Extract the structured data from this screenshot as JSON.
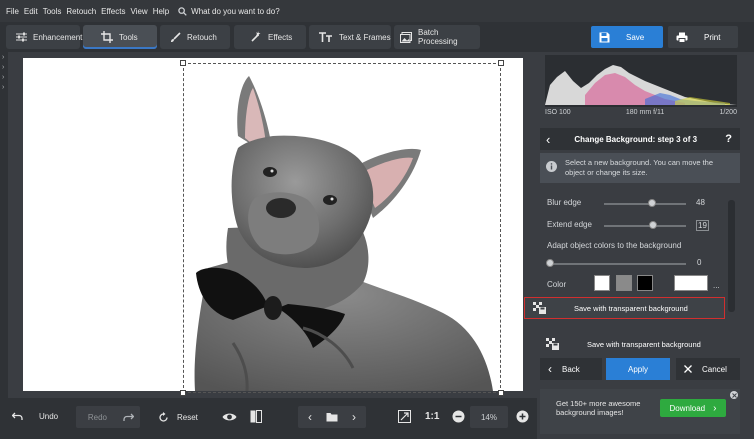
{
  "menu": [
    "File",
    "Edit",
    "Tools",
    "Retouch",
    "Effects",
    "View",
    "Help"
  ],
  "search_placeholder": "What do you want to do?",
  "tabs": [
    {
      "label": "Enhancement",
      "icon": "sliders-icon"
    },
    {
      "label": "Tools",
      "icon": "crop-icon"
    },
    {
      "label": "Retouch",
      "icon": "brush-icon"
    },
    {
      "label": "Effects",
      "icon": "magic-wand-icon"
    },
    {
      "label": "Text & Frames",
      "icon": "text-icon"
    },
    {
      "label": "Batch Processing",
      "icon": "images-icon"
    }
  ],
  "save_label": "Save",
  "print_label": "Print",
  "exif": {
    "iso": "ISO 100",
    "lens": "180 mm f/11",
    "shutter": "1/200"
  },
  "panel": {
    "step_title": "Change Background: step 3 of 3",
    "help": "?",
    "info": "Select a new background. You can move the object or change its size.",
    "blur_label": "Blur edge",
    "blur_value": "48",
    "blur_level": 0.58,
    "extend_label": "Extend edge",
    "extend_value": "19",
    "extend_level": 0.6,
    "adapt_label": "Adapt object colors to the background",
    "adapt_value": "0",
    "adapt_level": 0.0,
    "color_label": "Color",
    "more": "...",
    "save_transparent": "Save with transparent background",
    "save_transparent_2": "Save with transparent background",
    "back": "Back",
    "apply": "Apply",
    "cancel": "Cancel"
  },
  "promo": {
    "text": "Get 150+ more awesome background images!",
    "download": "Download"
  },
  "bottom": {
    "undo": "Undo",
    "redo": "Redo",
    "reset": "Reset",
    "ratio": "1:1",
    "zoom": "14%"
  },
  "colors": {
    "accent": "#2a7fd6",
    "apply": "#2a7fd6",
    "download": "#2eaa3f",
    "highlight": "#d12f2f"
  }
}
